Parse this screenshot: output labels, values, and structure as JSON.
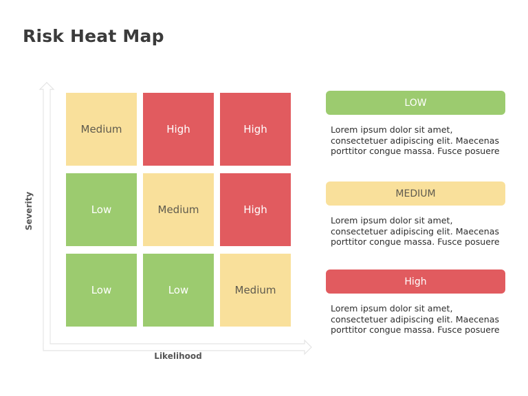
{
  "title": "Risk Heat Map",
  "axes": {
    "y_label": "Severity",
    "x_label": "Likelihood"
  },
  "colors": {
    "low": "#9ccb6f",
    "medium": "#f9e09b",
    "high": "#e15b5f"
  },
  "grid": {
    "rows": [
      [
        "Medium",
        "High",
        "High"
      ],
      [
        "Low",
        "Medium",
        "High"
      ],
      [
        "Low",
        "Low",
        "Medium"
      ]
    ]
  },
  "legend": [
    {
      "label": "LOW",
      "level": "low",
      "description": "Lorem ipsum dolor sit amet, consectetuer adipiscing elit. Maecenas porttitor congue massa. Fusce posuere"
    },
    {
      "label": "MEDIUM",
      "level": "medium",
      "description": "Lorem ipsum dolor sit amet, consectetuer adipiscing elit. Maecenas porttitor congue massa. Fusce posuere"
    },
    {
      "label": "High",
      "level": "high",
      "description": "Lorem ipsum dolor sit amet, consectetuer adipiscing elit. Maecenas porttitor congue massa. Fusce posuere"
    }
  ]
}
